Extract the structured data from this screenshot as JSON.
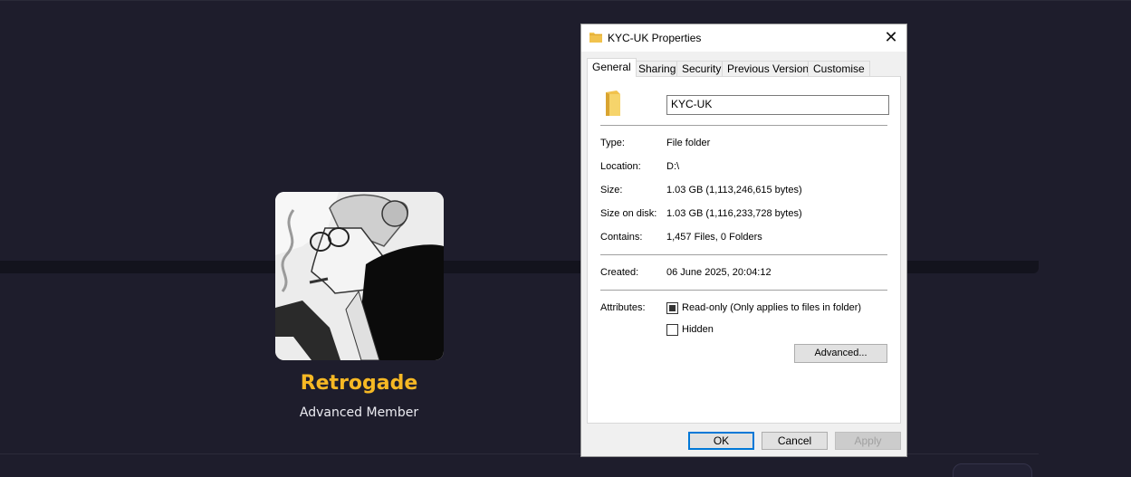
{
  "profile": {
    "username": "Retrogade",
    "role": "Advanced Member"
  },
  "dialog": {
    "title": "KYC-UK Properties",
    "close_symbol": "✕",
    "tabs": [
      {
        "label": "General",
        "active": true
      },
      {
        "label": "Sharing",
        "active": false
      },
      {
        "label": "Security",
        "active": false
      },
      {
        "label": "Previous Versions",
        "active": false
      },
      {
        "label": "Customise",
        "active": false
      }
    ],
    "name_value": "KYC-UK",
    "fields": {
      "type_label": "Type:",
      "type_value": "File folder",
      "location_label": "Location:",
      "location_value": "D:\\",
      "size_label": "Size:",
      "size_value": "1.03 GB (1,113,246,615 bytes)",
      "size_on_disk_label": "Size on disk:",
      "size_on_disk_value": "1.03 GB (1,116,233,728 bytes)",
      "contains_label": "Contains:",
      "contains_value": "1,457 Files, 0 Folders",
      "created_label": "Created:",
      "created_value": "06 June 2025, 20:04:12",
      "attributes_label": "Attributes:"
    },
    "attributes": {
      "readonly_label": "Read-only (Only applies to files in folder)",
      "readonly_state": "indeterminate",
      "hidden_label": "Hidden",
      "hidden_state": "unchecked",
      "advanced_button": "Advanced..."
    },
    "buttons": {
      "ok": "OK",
      "cancel": "Cancel",
      "apply": "Apply"
    }
  },
  "colors": {
    "background": "#1e1d2c",
    "username": "#f6b824",
    "focus": "#0078d7",
    "folder": "#f1c24d"
  },
  "icons": {
    "folder": "folder-icon",
    "close": "close-icon"
  }
}
